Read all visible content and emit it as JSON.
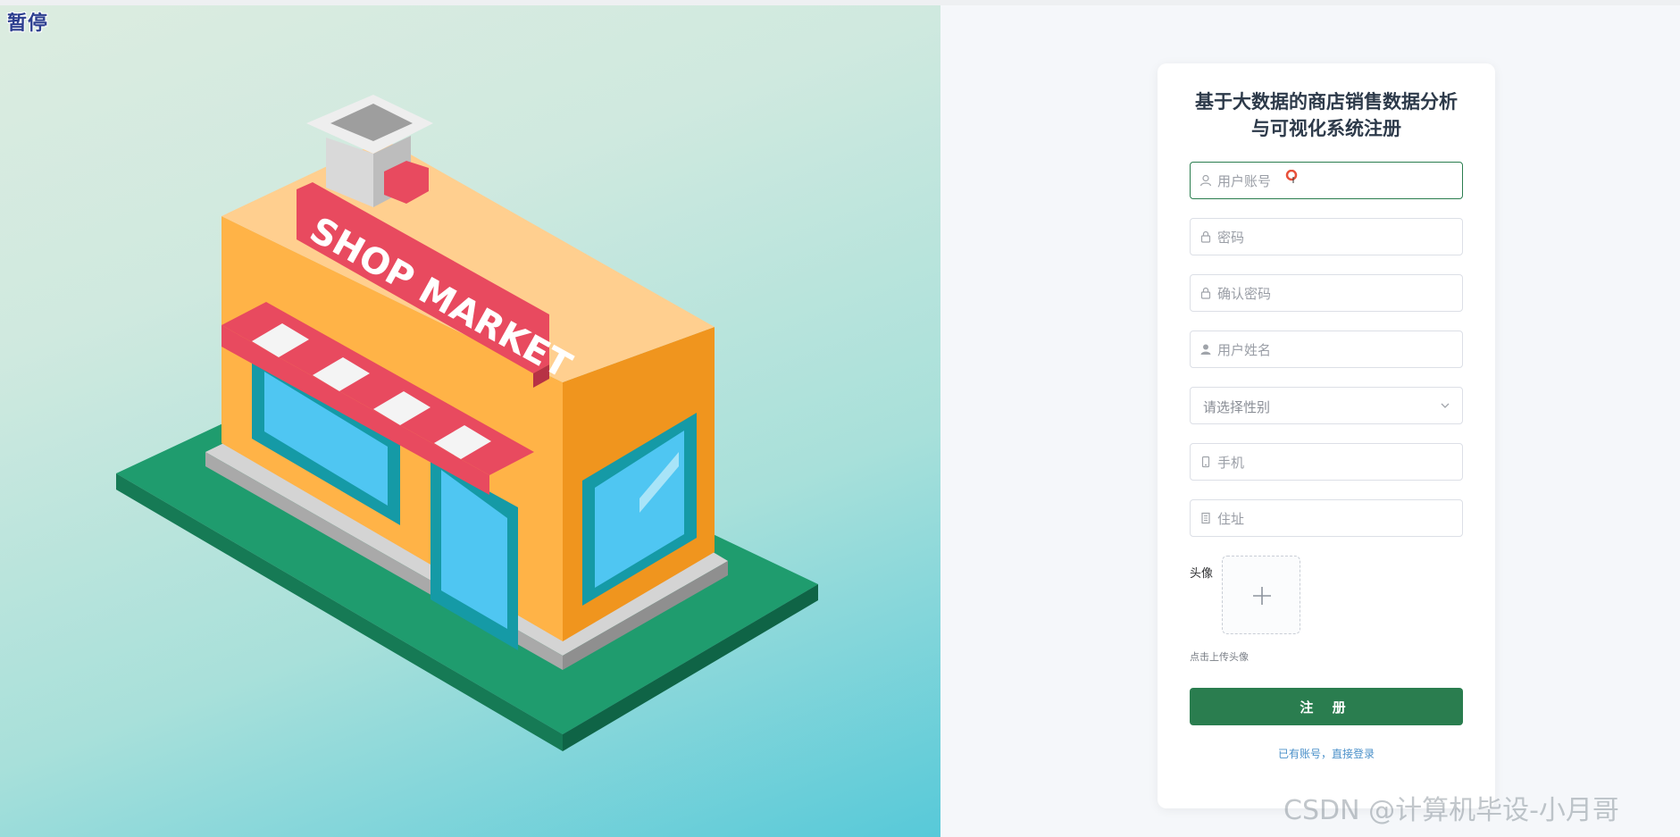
{
  "overlay": {
    "pause_label": "暂停"
  },
  "illustration": {
    "sign_text": "SHOP MARKET"
  },
  "form": {
    "title_line1": "基于大数据的商店销售数据分析",
    "title_line2": "与可视化系统注册",
    "fields": [
      {
        "placeholder": "用户账号",
        "value": "",
        "icon": "user-outline-icon"
      },
      {
        "placeholder": "密码",
        "value": "",
        "icon": "lock-icon"
      },
      {
        "placeholder": "确认密码",
        "value": "",
        "icon": "lock-icon"
      },
      {
        "placeholder": "用户姓名",
        "value": "",
        "icon": "user-filled-icon"
      }
    ],
    "gender_select": {
      "placeholder": "请选择性别",
      "icon": "chevron-down-icon"
    },
    "fields2": [
      {
        "placeholder": "手机",
        "value": "",
        "icon": "mobile-icon"
      },
      {
        "placeholder": "住址",
        "value": "",
        "icon": "building-icon"
      }
    ],
    "avatar_label": "头像",
    "avatar_tip": "点击上传头像",
    "submit_label": "注 册",
    "login_link": "已有账号，直接登录"
  },
  "watermark": "CSDN @计算机毕设-小月哥",
  "colors": {
    "primary": "#2a7d4f",
    "link": "#4a90c9",
    "page_bg": "#f5f7fa",
    "title": "#2d3a4a"
  }
}
